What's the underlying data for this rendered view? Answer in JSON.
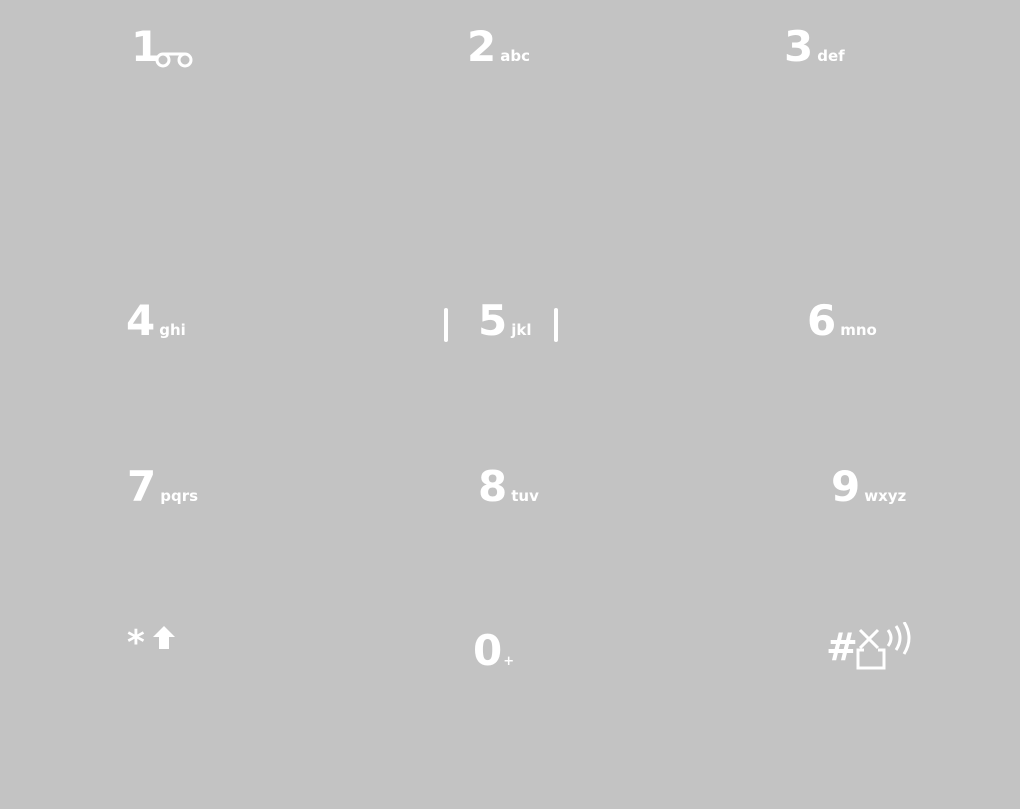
{
  "keypad": {
    "keys": [
      {
        "digit": "1",
        "letters": "",
        "icon": "voicemail-icon"
      },
      {
        "digit": "2",
        "letters": "abc"
      },
      {
        "digit": "3",
        "letters": "def"
      },
      {
        "digit": "4",
        "letters": "ghi"
      },
      {
        "digit": "5",
        "letters": "jkl",
        "focused": true
      },
      {
        "digit": "6",
        "letters": "mno"
      },
      {
        "digit": "7",
        "letters": "pqrs"
      },
      {
        "digit": "8",
        "letters": "tuv"
      },
      {
        "digit": "9",
        "letters": "wxyz"
      },
      {
        "digit": "*",
        "letters": "",
        "icon": "shift-arrow-icon"
      },
      {
        "digit": "0",
        "letters": "+"
      },
      {
        "digit": "#",
        "letters": "",
        "icon": "vibrate-off-icon"
      }
    ]
  },
  "colors": {
    "background": "#c3c3c3",
    "text": "#ffffff"
  }
}
